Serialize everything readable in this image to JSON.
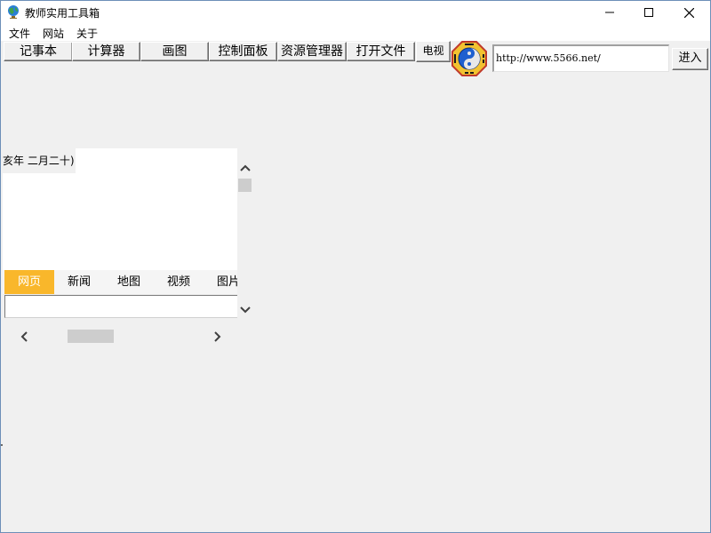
{
  "window": {
    "title": "教师实用工具箱",
    "controls": [
      "minimize-icon",
      "maximize-icon",
      "close-icon"
    ]
  },
  "menu": {
    "items": [
      {
        "label": "文件"
      },
      {
        "label": "网站"
      },
      {
        "label": "关于"
      }
    ]
  },
  "toolbar": {
    "buttons": [
      {
        "label": "记事本"
      },
      {
        "label": "计算器"
      },
      {
        "label": "画图"
      },
      {
        "label": "控制面板"
      },
      {
        "label": "资源管理器"
      },
      {
        "label": "打开文件"
      },
      {
        "label": "电视"
      }
    ],
    "logo_icon": "bagua-taiji-icon",
    "url_value": "http://www.5566.net/",
    "go_label": "进入"
  },
  "calendar": {
    "lunar_date_text": "亥年 二月二十)"
  },
  "search": {
    "tabs": [
      {
        "label": "网页",
        "active": true
      },
      {
        "label": "新闻"
      },
      {
        "label": "地图"
      },
      {
        "label": "视频"
      },
      {
        "label": "图片"
      }
    ],
    "active_tab_color": "#f9b72b",
    "query_value": ""
  },
  "colors": {
    "window_bg": "#f0f0f0",
    "titlebar_bg": "#ffffff",
    "window_border": "#6d8fb8"
  }
}
